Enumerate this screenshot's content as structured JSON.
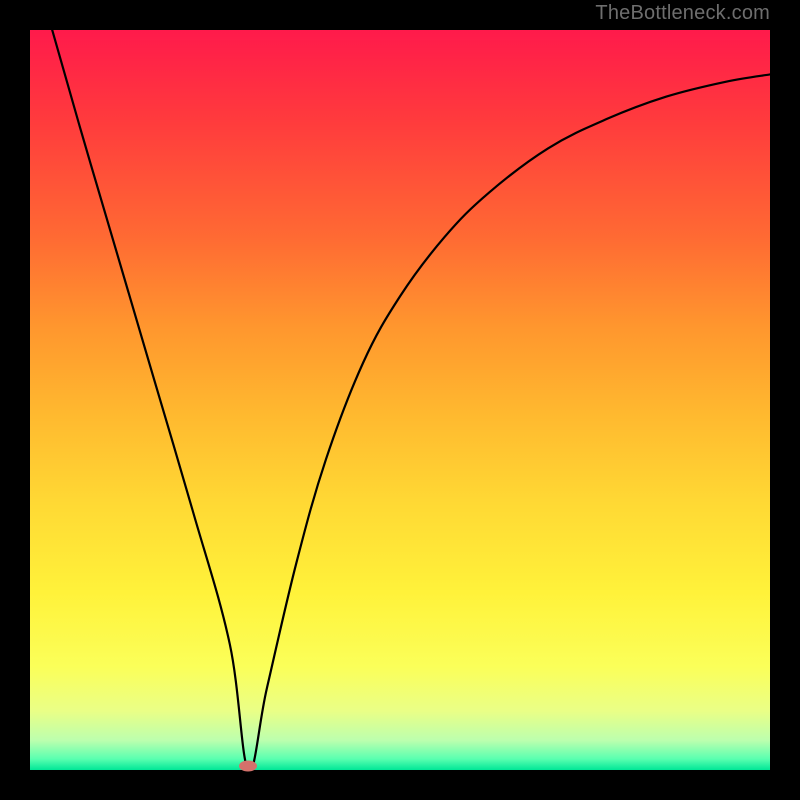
{
  "watermark": "TheBottleneck.com",
  "chart_data": {
    "type": "line",
    "title": "",
    "xlabel": "",
    "ylabel": "",
    "xlim": [
      0,
      100
    ],
    "ylim": [
      0,
      100
    ],
    "grid": false,
    "legend": false,
    "series": [
      {
        "name": "curve",
        "x": [
          3,
          7,
          12,
          17,
          22,
          27,
          29.5,
          32,
          36,
          40,
          45,
          50,
          56,
          62,
          70,
          78,
          86,
          94,
          100
        ],
        "y": [
          100,
          86,
          69,
          52,
          35,
          17,
          0,
          11,
          28,
          42,
          55,
          64,
          72,
          78,
          84,
          88,
          91,
          93,
          94
        ]
      }
    ],
    "marker": {
      "x": 29.5,
      "y": 0.5,
      "color": "#d4716b"
    },
    "background_gradient": {
      "top": "#ff1a4b",
      "bottom": "#00e797"
    }
  }
}
